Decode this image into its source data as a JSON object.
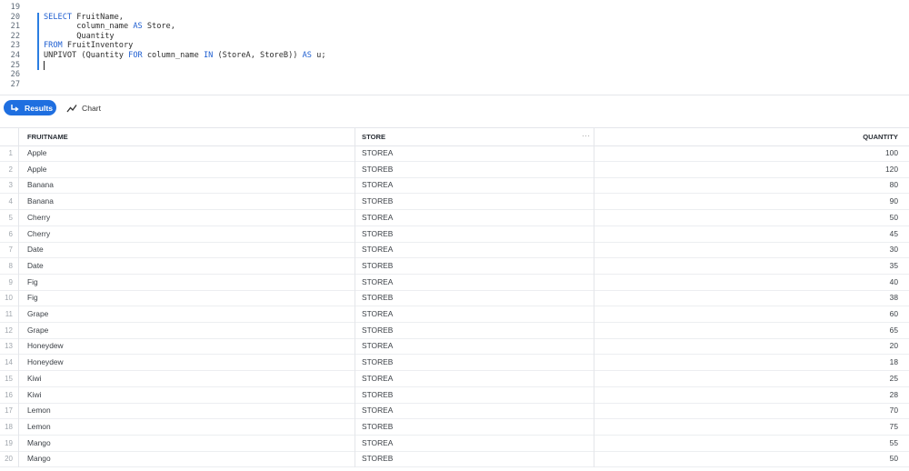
{
  "editor": {
    "lines": [
      {
        "num": "19",
        "parts": []
      },
      {
        "num": "20",
        "parts": [
          {
            "t": "SELECT",
            "k": true
          },
          {
            "t": " FruitName,",
            "k": false
          }
        ]
      },
      {
        "num": "21",
        "parts": [
          {
            "t": "       column_name ",
            "k": false
          },
          {
            "t": "AS",
            "k": true
          },
          {
            "t": " Store,",
            "k": false
          }
        ]
      },
      {
        "num": "22",
        "parts": [
          {
            "t": "       Quantity",
            "k": false
          }
        ]
      },
      {
        "num": "23",
        "parts": [
          {
            "t": "FROM",
            "k": true
          },
          {
            "t": " FruitInventory",
            "k": false
          }
        ]
      },
      {
        "num": "24",
        "parts": [
          {
            "t": "UNPIVOT (Quantity ",
            "k": false
          },
          {
            "t": "FOR",
            "k": true
          },
          {
            "t": " column_name ",
            "k": false
          },
          {
            "t": "IN",
            "k": true
          },
          {
            "t": " (StoreA, StoreB)) ",
            "k": false
          },
          {
            "t": "AS",
            "k": true
          },
          {
            "t": " u;",
            "k": false
          }
        ]
      },
      {
        "num": "25",
        "parts": [],
        "cursor": true
      },
      {
        "num": "26",
        "parts": []
      },
      {
        "num": "27",
        "parts": []
      }
    ]
  },
  "tabs": {
    "results_label": "Results",
    "chart_label": "Chart"
  },
  "table": {
    "headers": {
      "fruit": "FRUITNAME",
      "store": "STORE",
      "quantity": "QUANTITY"
    },
    "kebab": "···",
    "rows": [
      {
        "n": "1",
        "fruit": "Apple",
        "store": "STOREA",
        "qty": "100"
      },
      {
        "n": "2",
        "fruit": "Apple",
        "store": "STOREB",
        "qty": "120"
      },
      {
        "n": "3",
        "fruit": "Banana",
        "store": "STOREA",
        "qty": "80"
      },
      {
        "n": "4",
        "fruit": "Banana",
        "store": "STOREB",
        "qty": "90"
      },
      {
        "n": "5",
        "fruit": "Cherry",
        "store": "STOREA",
        "qty": "50"
      },
      {
        "n": "6",
        "fruit": "Cherry",
        "store": "STOREB",
        "qty": "45"
      },
      {
        "n": "7",
        "fruit": "Date",
        "store": "STOREA",
        "qty": "30"
      },
      {
        "n": "8",
        "fruit": "Date",
        "store": "STOREB",
        "qty": "35"
      },
      {
        "n": "9",
        "fruit": "Fig",
        "store": "STOREA",
        "qty": "40"
      },
      {
        "n": "10",
        "fruit": "Fig",
        "store": "STOREB",
        "qty": "38"
      },
      {
        "n": "11",
        "fruit": "Grape",
        "store": "STOREA",
        "qty": "60"
      },
      {
        "n": "12",
        "fruit": "Grape",
        "store": "STOREB",
        "qty": "65"
      },
      {
        "n": "13",
        "fruit": "Honeydew",
        "store": "STOREA",
        "qty": "20"
      },
      {
        "n": "14",
        "fruit": "Honeydew",
        "store": "STOREB",
        "qty": "18"
      },
      {
        "n": "15",
        "fruit": "Kiwi",
        "store": "STOREA",
        "qty": "25"
      },
      {
        "n": "16",
        "fruit": "Kiwi",
        "store": "STOREB",
        "qty": "28"
      },
      {
        "n": "17",
        "fruit": "Lemon",
        "store": "STOREA",
        "qty": "70"
      },
      {
        "n": "18",
        "fruit": "Lemon",
        "store": "STOREB",
        "qty": "75"
      },
      {
        "n": "19",
        "fruit": "Mango",
        "store": "STOREA",
        "qty": "55"
      },
      {
        "n": "20",
        "fruit": "Mango",
        "store": "STOREB",
        "qty": "50"
      }
    ]
  },
  "colors": {
    "accent": "#1f6fe0",
    "keyword": "#1f5fd1",
    "gutter_bar": "#2a7de1"
  }
}
